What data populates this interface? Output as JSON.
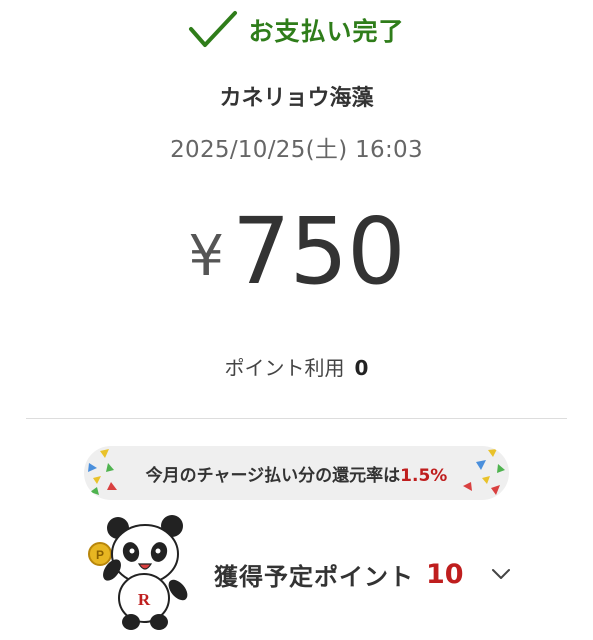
{
  "status": {
    "title": "お支払い完了",
    "icon": "check-icon",
    "color": "#2f7d1a"
  },
  "merchant": {
    "name": "カネリョウ海藻"
  },
  "transaction": {
    "datetime": "2025/10/25(土) 16:03"
  },
  "amount": {
    "currency_symbol": "¥",
    "value": "750"
  },
  "points_used": {
    "label": "ポイント利用",
    "value": "0"
  },
  "campaign": {
    "text": "今月のチャージ払い分の還元率は",
    "rate": "1.5%",
    "accent": "#bf1e1e"
  },
  "earned_points": {
    "label": "獲得予定ポイント",
    "value": "10",
    "expand_icon": "chevron-down-icon",
    "mascot_icon": "panda-mascot-icon"
  }
}
